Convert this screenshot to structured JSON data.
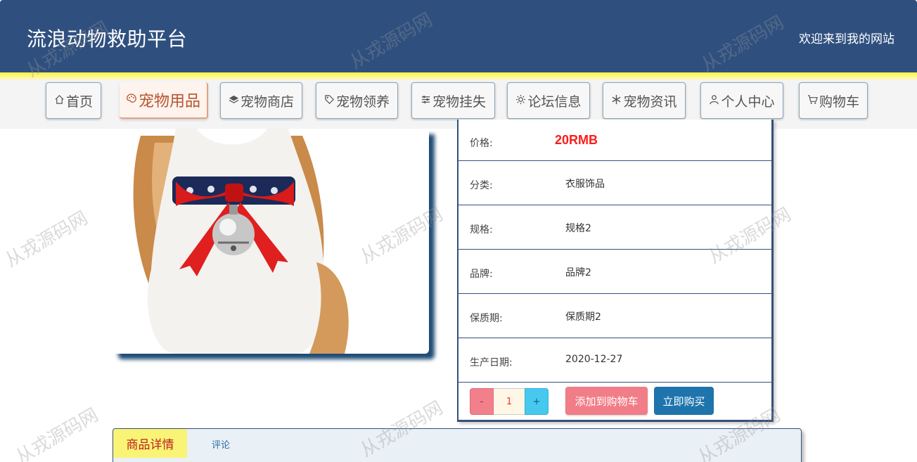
{
  "header": {
    "site_title": "流浪动物救助平台",
    "welcome": "欢迎来到我的网站",
    "bg_color": "#2f507f"
  },
  "nav": {
    "items": [
      {
        "label": "首页",
        "icon": "home-icon",
        "active": false
      },
      {
        "label": "宠物用品",
        "icon": "palette-icon",
        "active": true
      },
      {
        "label": "宠物商店",
        "icon": "layers-icon",
        "active": false
      },
      {
        "label": "宠物领养",
        "icon": "tag-icon",
        "active": false
      },
      {
        "label": "宠物挂失",
        "icon": "sliders-icon",
        "active": false
      },
      {
        "label": "论坛信息",
        "icon": "gear-icon",
        "active": false
      },
      {
        "label": "宠物资讯",
        "icon": "snowflake-icon",
        "active": false
      },
      {
        "label": "个人中心",
        "icon": "user-icon",
        "active": false
      },
      {
        "label": "购物车",
        "icon": "cart-icon",
        "active": false
      }
    ]
  },
  "product": {
    "image": "dog-with-bow-collar-and-bell",
    "fields": [
      {
        "label": "价格:",
        "value": "20RMB",
        "kind": "price"
      },
      {
        "label": "分类:",
        "value": "衣服饰品"
      },
      {
        "label": "规格:",
        "value": "规格2"
      },
      {
        "label": "品牌:",
        "value": "品牌2"
      },
      {
        "label": "保质期:",
        "value": "保质期2"
      },
      {
        "label": "生产日期:",
        "value": "2020-12-27"
      }
    ],
    "quantity": {
      "minus": "-",
      "value": "1",
      "plus": "+"
    },
    "add_to_cart": "添加到购物车",
    "buy_now": "立即购买",
    "price_color": "#ff1a1a"
  },
  "tabs": {
    "detail": "商品详情",
    "comment": "评论"
  },
  "watermark": "从戎源码网"
}
